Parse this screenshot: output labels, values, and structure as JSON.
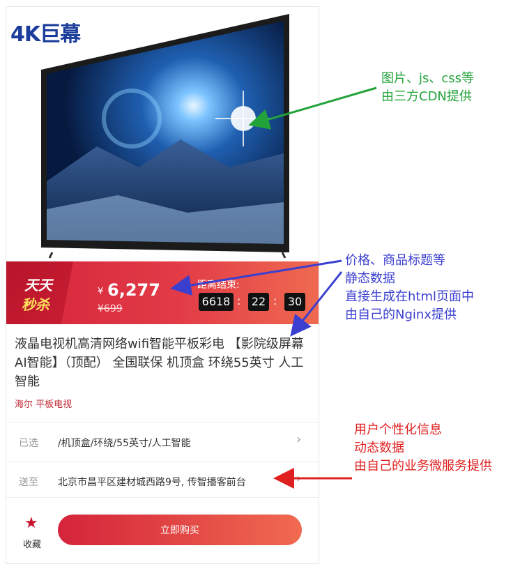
{
  "product": {
    "image_badge": "4K巨幕",
    "seckill_line1": "天天",
    "seckill_line2": "秒杀",
    "price_symbol": "¥",
    "price": "6,277",
    "original_price": "¥699",
    "countdown_label": "距离结束:",
    "countdown": [
      "6618",
      "22",
      "30"
    ],
    "countdown_sep": ":",
    "title": "液晶电视机高清网络wifi智能平板彩电 【影院级屏幕AI智能】（顶配） 全国联保 机顶盒 环绕55英寸 人工智能",
    "tags": "海尔 平板电视"
  },
  "options": {
    "selected_label": "已选",
    "selected_value": "/机顶盒/环绕/55英寸/人工智能",
    "ship_label": "送至",
    "ship_value": "北京市昌平区建材城西路9号, 传智播客前台",
    "chevron": "›"
  },
  "bottom_bar": {
    "favorite_label": "收藏",
    "buy_label": "立即购买"
  },
  "annotations": {
    "green": [
      "图片、js、css等",
      "由三方CDN提供"
    ],
    "blue": [
      "价格、商品标题等",
      "静态数据",
      "直接生成在html页面中",
      "由自己的Nginx提供"
    ],
    "red": [
      "用户个性化信息",
      "动态数据",
      "由自己的业务微服务提供"
    ]
  },
  "colors": {
    "green": "#22a33a",
    "blue": "#3b3fcf",
    "red": "#e02020",
    "brand_red": "#d4243a"
  }
}
